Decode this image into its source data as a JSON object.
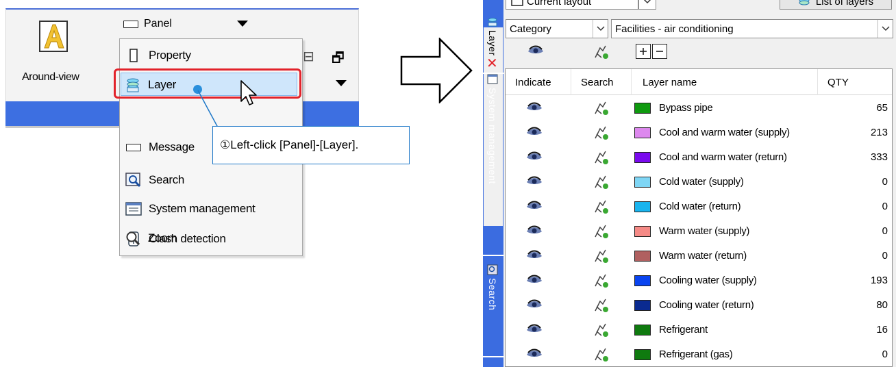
{
  "ribbon": {
    "around_view_label": "Around-view",
    "panel_label": "Panel"
  },
  "menu": {
    "items": [
      {
        "label": "Property",
        "icon": "property-icon"
      },
      {
        "label": "Layer",
        "icon": "layer-icon"
      },
      {
        "label": "Message",
        "icon": "message-icon"
      },
      {
        "label": "Search",
        "icon": "search-icon"
      },
      {
        "label": "System management",
        "icon": "system-management-icon"
      },
      {
        "label": "Clash detection",
        "icon": "clash-detection-icon"
      },
      {
        "label": "Zoom",
        "icon": "zoom-icon"
      }
    ],
    "highlighted": "Layer"
  },
  "callout": {
    "text": "①Left-click [Panel]-[Layer]."
  },
  "side_tabs": {
    "layer": "Layer",
    "system_management": "System management",
    "search": "Search"
  },
  "layer_panel": {
    "current_layout": "Current layout",
    "list_of_layers": "List of layers",
    "filter_type": "Category",
    "filter_value": "Facilities - air conditioning",
    "columns": [
      "Indicate",
      "Search",
      "Layer name",
      "QTY"
    ],
    "rows": [
      {
        "name": "Bypass pipe",
        "qty": "65",
        "color": "#0f9a0f"
      },
      {
        "name": "Cool and warm water (supply)",
        "qty": "213",
        "color": "#dd88ee"
      },
      {
        "name": "Cool and warm water (return)",
        "qty": "333",
        "color": "#7a0aee"
      },
      {
        "name": "Cold water (supply)",
        "qty": "0",
        "color": "#7fd6f5"
      },
      {
        "name": "Cold water (return)",
        "qty": "0",
        "color": "#19b4ee"
      },
      {
        "name": "Warm water (supply)",
        "qty": "0",
        "color": "#f58a86"
      },
      {
        "name": "Warm water (return)",
        "qty": "0",
        "color": "#b06060"
      },
      {
        "name": "Cooling water (supply)",
        "qty": "193",
        "color": "#0a44f0"
      },
      {
        "name": "Cooling water (return)",
        "qty": "80",
        "color": "#0a2a90"
      },
      {
        "name": "Refrigerant",
        "qty": "16",
        "color": "#0f7a0f"
      },
      {
        "name": "Refrigerant (gas)",
        "qty": "0",
        "color": "#0f7a0f"
      }
    ]
  },
  "colors": {
    "accent_blue": "#3b6ce0",
    "highlight_red": "#e2222a"
  }
}
